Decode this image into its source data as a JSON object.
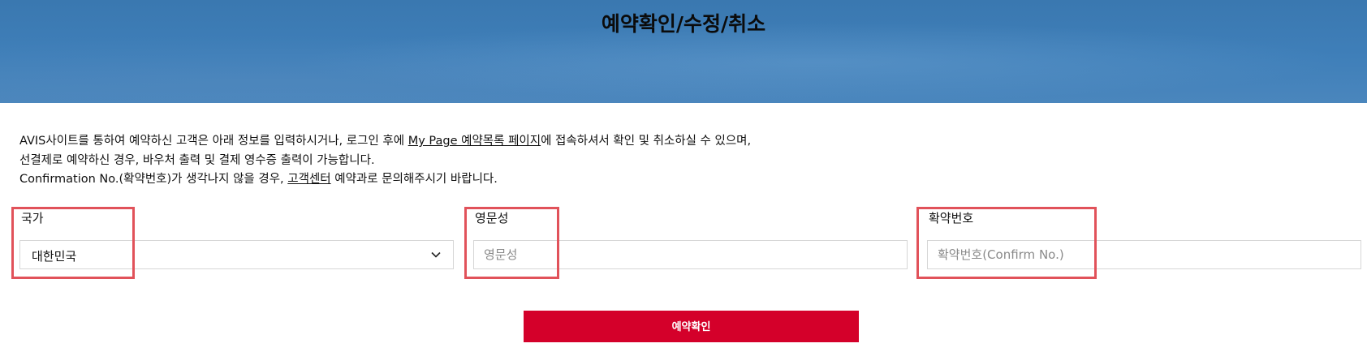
{
  "hero": {
    "title": "예약확인/수정/취소"
  },
  "intro": {
    "line1_before": "AVIS사이트를 통하여 예약하신 고객은 아래 정보를 입력하시거나, 로그인 후에 ",
    "line1_link": "My Page 예약목록 페이지",
    "line1_after": "에 접속하셔서 확인 및 취소하실 수 있으며,",
    "line2": "선결제로 예약하신 경우, 바우처 출력 및 결제 영수증 출력이 가능합니다.",
    "line3_before": "Confirmation No.(확약번호)가 생각나지 않을 경우, ",
    "line3_link": "고객센터",
    "line3_after": " 예약과로 문의해주시기 바랍니다."
  },
  "form": {
    "country": {
      "label": "국가",
      "selected": "대한민국",
      "icon": "chevron-down-icon"
    },
    "last_name": {
      "label": "영문성",
      "placeholder": "영문성",
      "value": ""
    },
    "confirmation": {
      "label": "확약번호",
      "placeholder": "확약번호(Confirm No.)",
      "value": ""
    }
  },
  "submit": {
    "label": "예약확인"
  },
  "colors": {
    "hero_bg": "#3f7fb9",
    "highlight": "#e1525a",
    "submit_bg": "#d4002a"
  }
}
